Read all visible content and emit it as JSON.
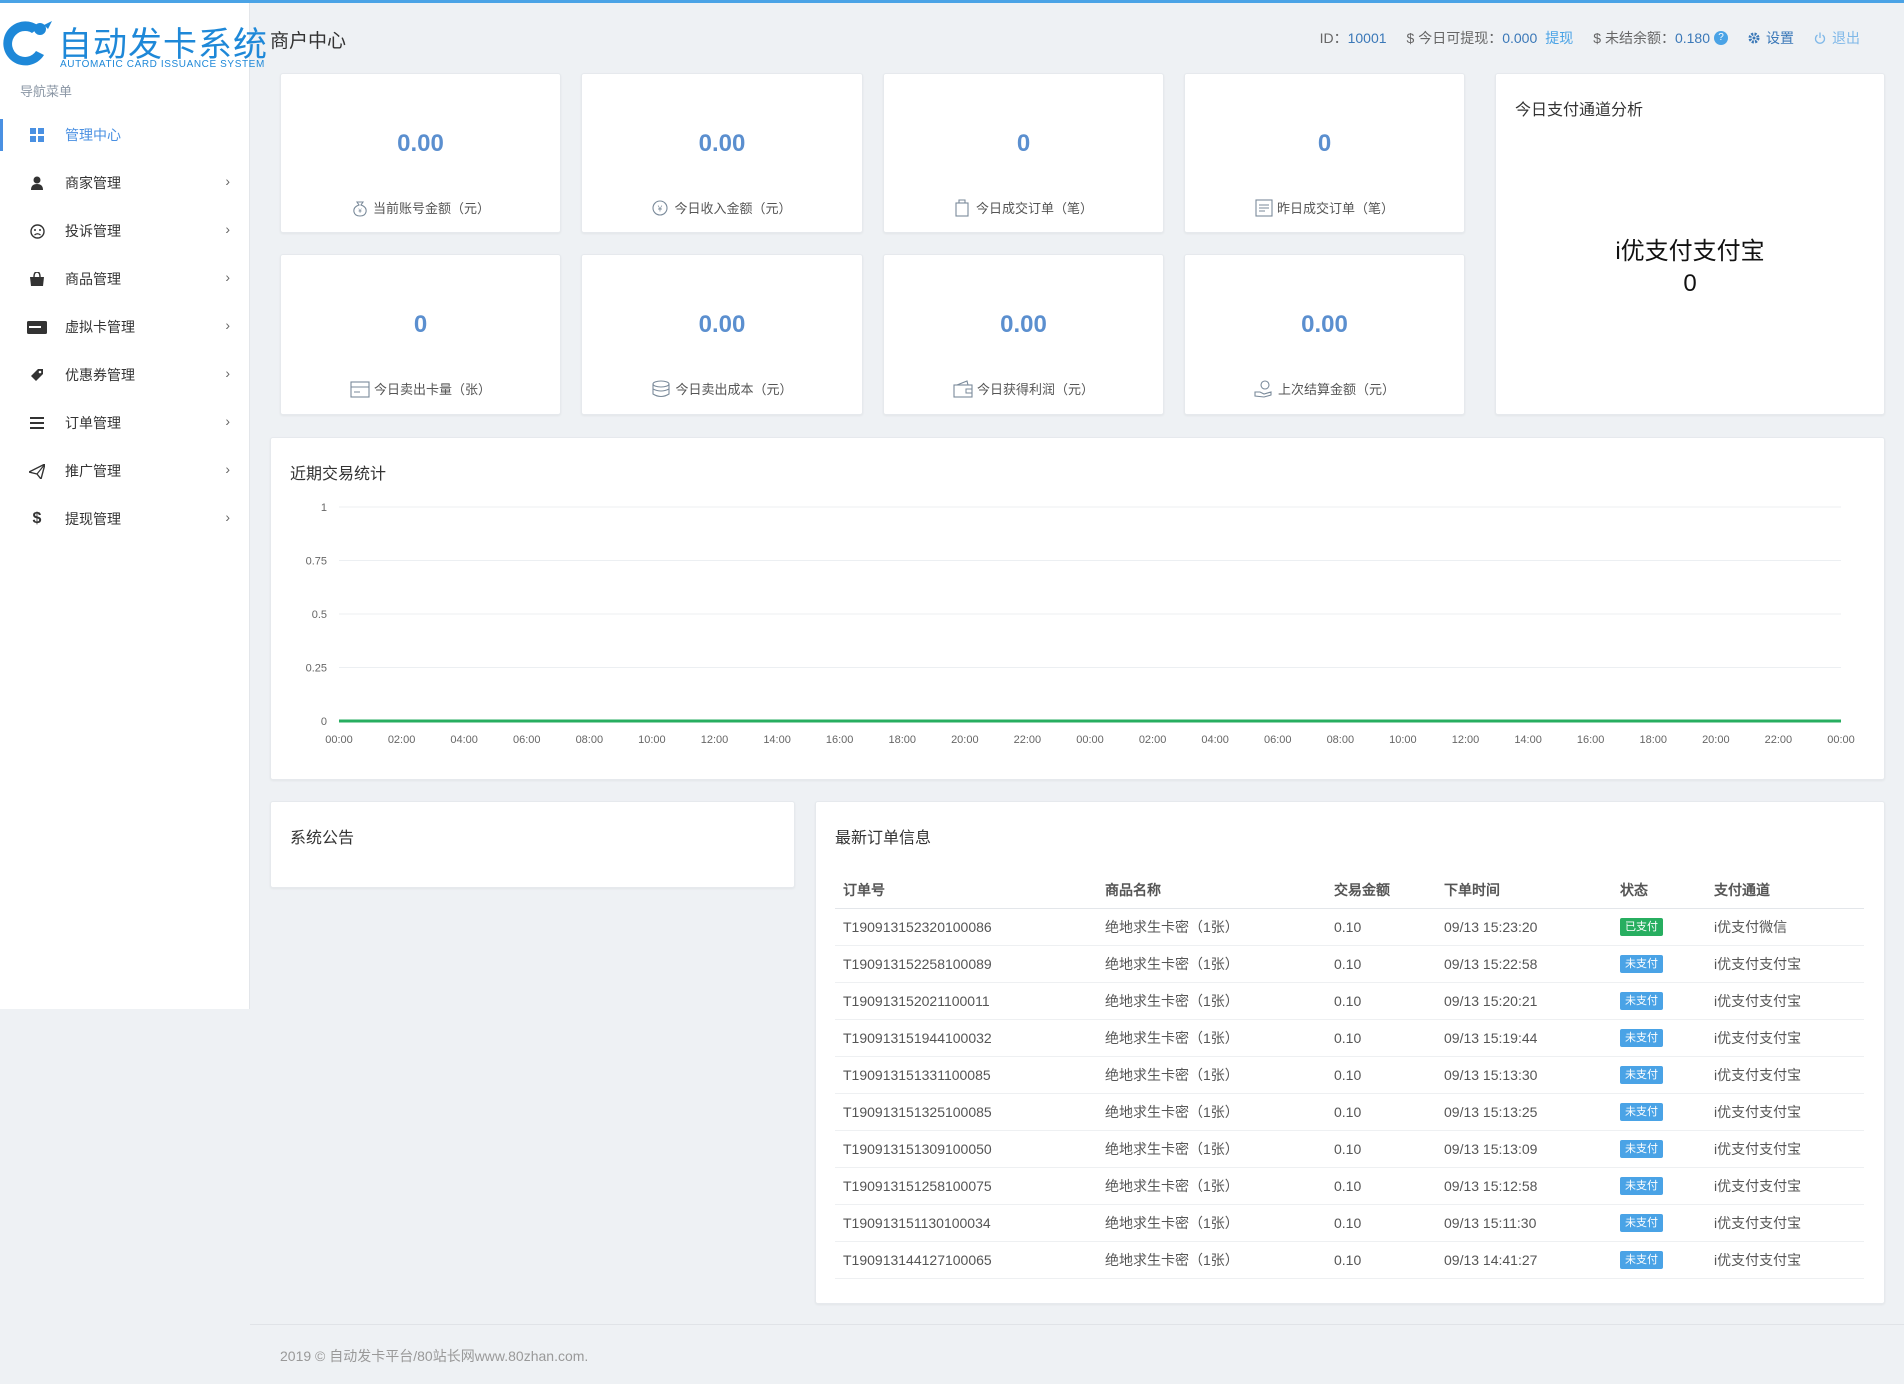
{
  "brand": {
    "title": "自动发卡系统",
    "subtitle": "AUTOMATIC CARD ISSUANCE SYSTEM",
    "color": "#1e88d8"
  },
  "sidebar": {
    "heading": "导航菜单",
    "items": [
      {
        "label": "管理中心",
        "icon": "dashboard-icon",
        "active": true
      },
      {
        "label": "商家管理",
        "icon": "user-icon"
      },
      {
        "label": "投诉管理",
        "icon": "frown-icon"
      },
      {
        "label": "商品管理",
        "icon": "shopping-bag-icon"
      },
      {
        "label": "虚拟卡管理",
        "icon": "credit-card-icon"
      },
      {
        "label": "优惠券管理",
        "icon": "ticket-icon"
      },
      {
        "label": "订单管理",
        "icon": "list-icon"
      },
      {
        "label": "推广管理",
        "icon": "paper-plane-icon"
      },
      {
        "label": "提现管理",
        "icon": "dollar-icon"
      }
    ]
  },
  "header": {
    "page_title": "商户中心",
    "id_label": "ID：",
    "id_value": "10001",
    "withdrawable_label": "$ 今日可提现：",
    "withdrawable_value": "0.000",
    "withdraw_link": "提现",
    "unsettled_label": "$ 未结余额：",
    "unsettled_value": "0.180",
    "help_mark": "?",
    "settings_label": "设置",
    "logout_label": "退出"
  },
  "stats": [
    {
      "value": "0.00",
      "label": "当前账号金额（元）",
      "icon": "money-bag-icon"
    },
    {
      "value": "0.00",
      "label": "今日收入金额（元）",
      "icon": "yen-coin-icon"
    },
    {
      "value": "0",
      "label": "今日成交订单（笔）",
      "icon": "order-bag-icon"
    },
    {
      "value": "0",
      "label": "昨日成交订单（笔）",
      "icon": "receipt-icon"
    },
    {
      "value": "0",
      "label": "今日卖出卡量（张）",
      "icon": "card-icon"
    },
    {
      "value": "0.00",
      "label": "今日卖出成本（元）",
      "icon": "coins-stack-icon"
    },
    {
      "value": "0.00",
      "label": "今日获得利润（元）",
      "icon": "wallet-icon"
    },
    {
      "value": "0.00",
      "label": "上次结算金额（元）",
      "icon": "settle-hand-icon"
    }
  ],
  "pay_channel": {
    "title": "今日支付通道分析",
    "channel_name": "i优支付支付宝",
    "channel_value": "0"
  },
  "trade_chart": {
    "title": "近期交易统计"
  },
  "chart_data": {
    "type": "line",
    "title": "近期交易统计",
    "x": [
      "00:00",
      "02:00",
      "04:00",
      "06:00",
      "08:00",
      "10:00",
      "12:00",
      "14:00",
      "16:00",
      "18:00",
      "20:00",
      "22:00",
      "00:00",
      "02:00",
      "04:00",
      "06:00",
      "08:00",
      "10:00",
      "12:00",
      "14:00",
      "16:00",
      "18:00",
      "20:00",
      "22:00",
      "00:00"
    ],
    "y_ticks": [
      "0",
      "0.25",
      "0.5",
      "0.75",
      "1"
    ],
    "ylim": [
      0,
      1
    ],
    "series": [
      {
        "values": [
          0,
          0,
          0,
          0,
          0,
          0,
          0,
          0,
          0,
          0,
          0,
          0,
          0,
          0,
          0,
          0,
          0,
          0,
          0,
          0,
          0,
          0,
          0,
          0,
          0
        ],
        "color": "#27ae60"
      }
    ],
    "grid": true
  },
  "notice": {
    "title": "系统公告"
  },
  "orders": {
    "title": "最新订单信息",
    "columns": [
      "订单号",
      "商品名称",
      "交易金额",
      "下单时间",
      "状态",
      "支付通道"
    ],
    "rows": [
      [
        "T190913152320100086",
        "绝地求生卡密（1张）",
        "0.10",
        "09/13 15:23:20",
        "已支付",
        "i优支付微信"
      ],
      [
        "T190913152258100089",
        "绝地求生卡密（1张）",
        "0.10",
        "09/13 15:22:58",
        "未支付",
        "i优支付支付宝"
      ],
      [
        "T190913152021100011",
        "绝地求生卡密（1张）",
        "0.10",
        "09/13 15:20:21",
        "未支付",
        "i优支付支付宝"
      ],
      [
        "T190913151944100032",
        "绝地求生卡密（1张）",
        "0.10",
        "09/13 15:19:44",
        "未支付",
        "i优支付支付宝"
      ],
      [
        "T190913151331100085",
        "绝地求生卡密（1张）",
        "0.10",
        "09/13 15:13:30",
        "未支付",
        "i优支付支付宝"
      ],
      [
        "T190913151325100085",
        "绝地求生卡密（1张）",
        "0.10",
        "09/13 15:13:25",
        "未支付",
        "i优支付支付宝"
      ],
      [
        "T190913151309100050",
        "绝地求生卡密（1张）",
        "0.10",
        "09/13 15:13:09",
        "未支付",
        "i优支付支付宝"
      ],
      [
        "T190913151258100075",
        "绝地求生卡密（1张）",
        "0.10",
        "09/13 15:12:58",
        "未支付",
        "i优支付支付宝"
      ],
      [
        "T190913151130100034",
        "绝地求生卡密（1张）",
        "0.10",
        "09/13 15:11:30",
        "未支付",
        "i优支付支付宝"
      ],
      [
        "T190913144127100065",
        "绝地求生卡密（1张）",
        "0.10",
        "09/13 14:41:27",
        "未支付",
        "i优支付支付宝"
      ]
    ],
    "status_colors": {
      "已支付": "#27ae60",
      "未支付": "#4aa3e6"
    }
  },
  "footer": {
    "text": "2019 © 自动发卡平台/80站长网www.80zhan.com."
  }
}
